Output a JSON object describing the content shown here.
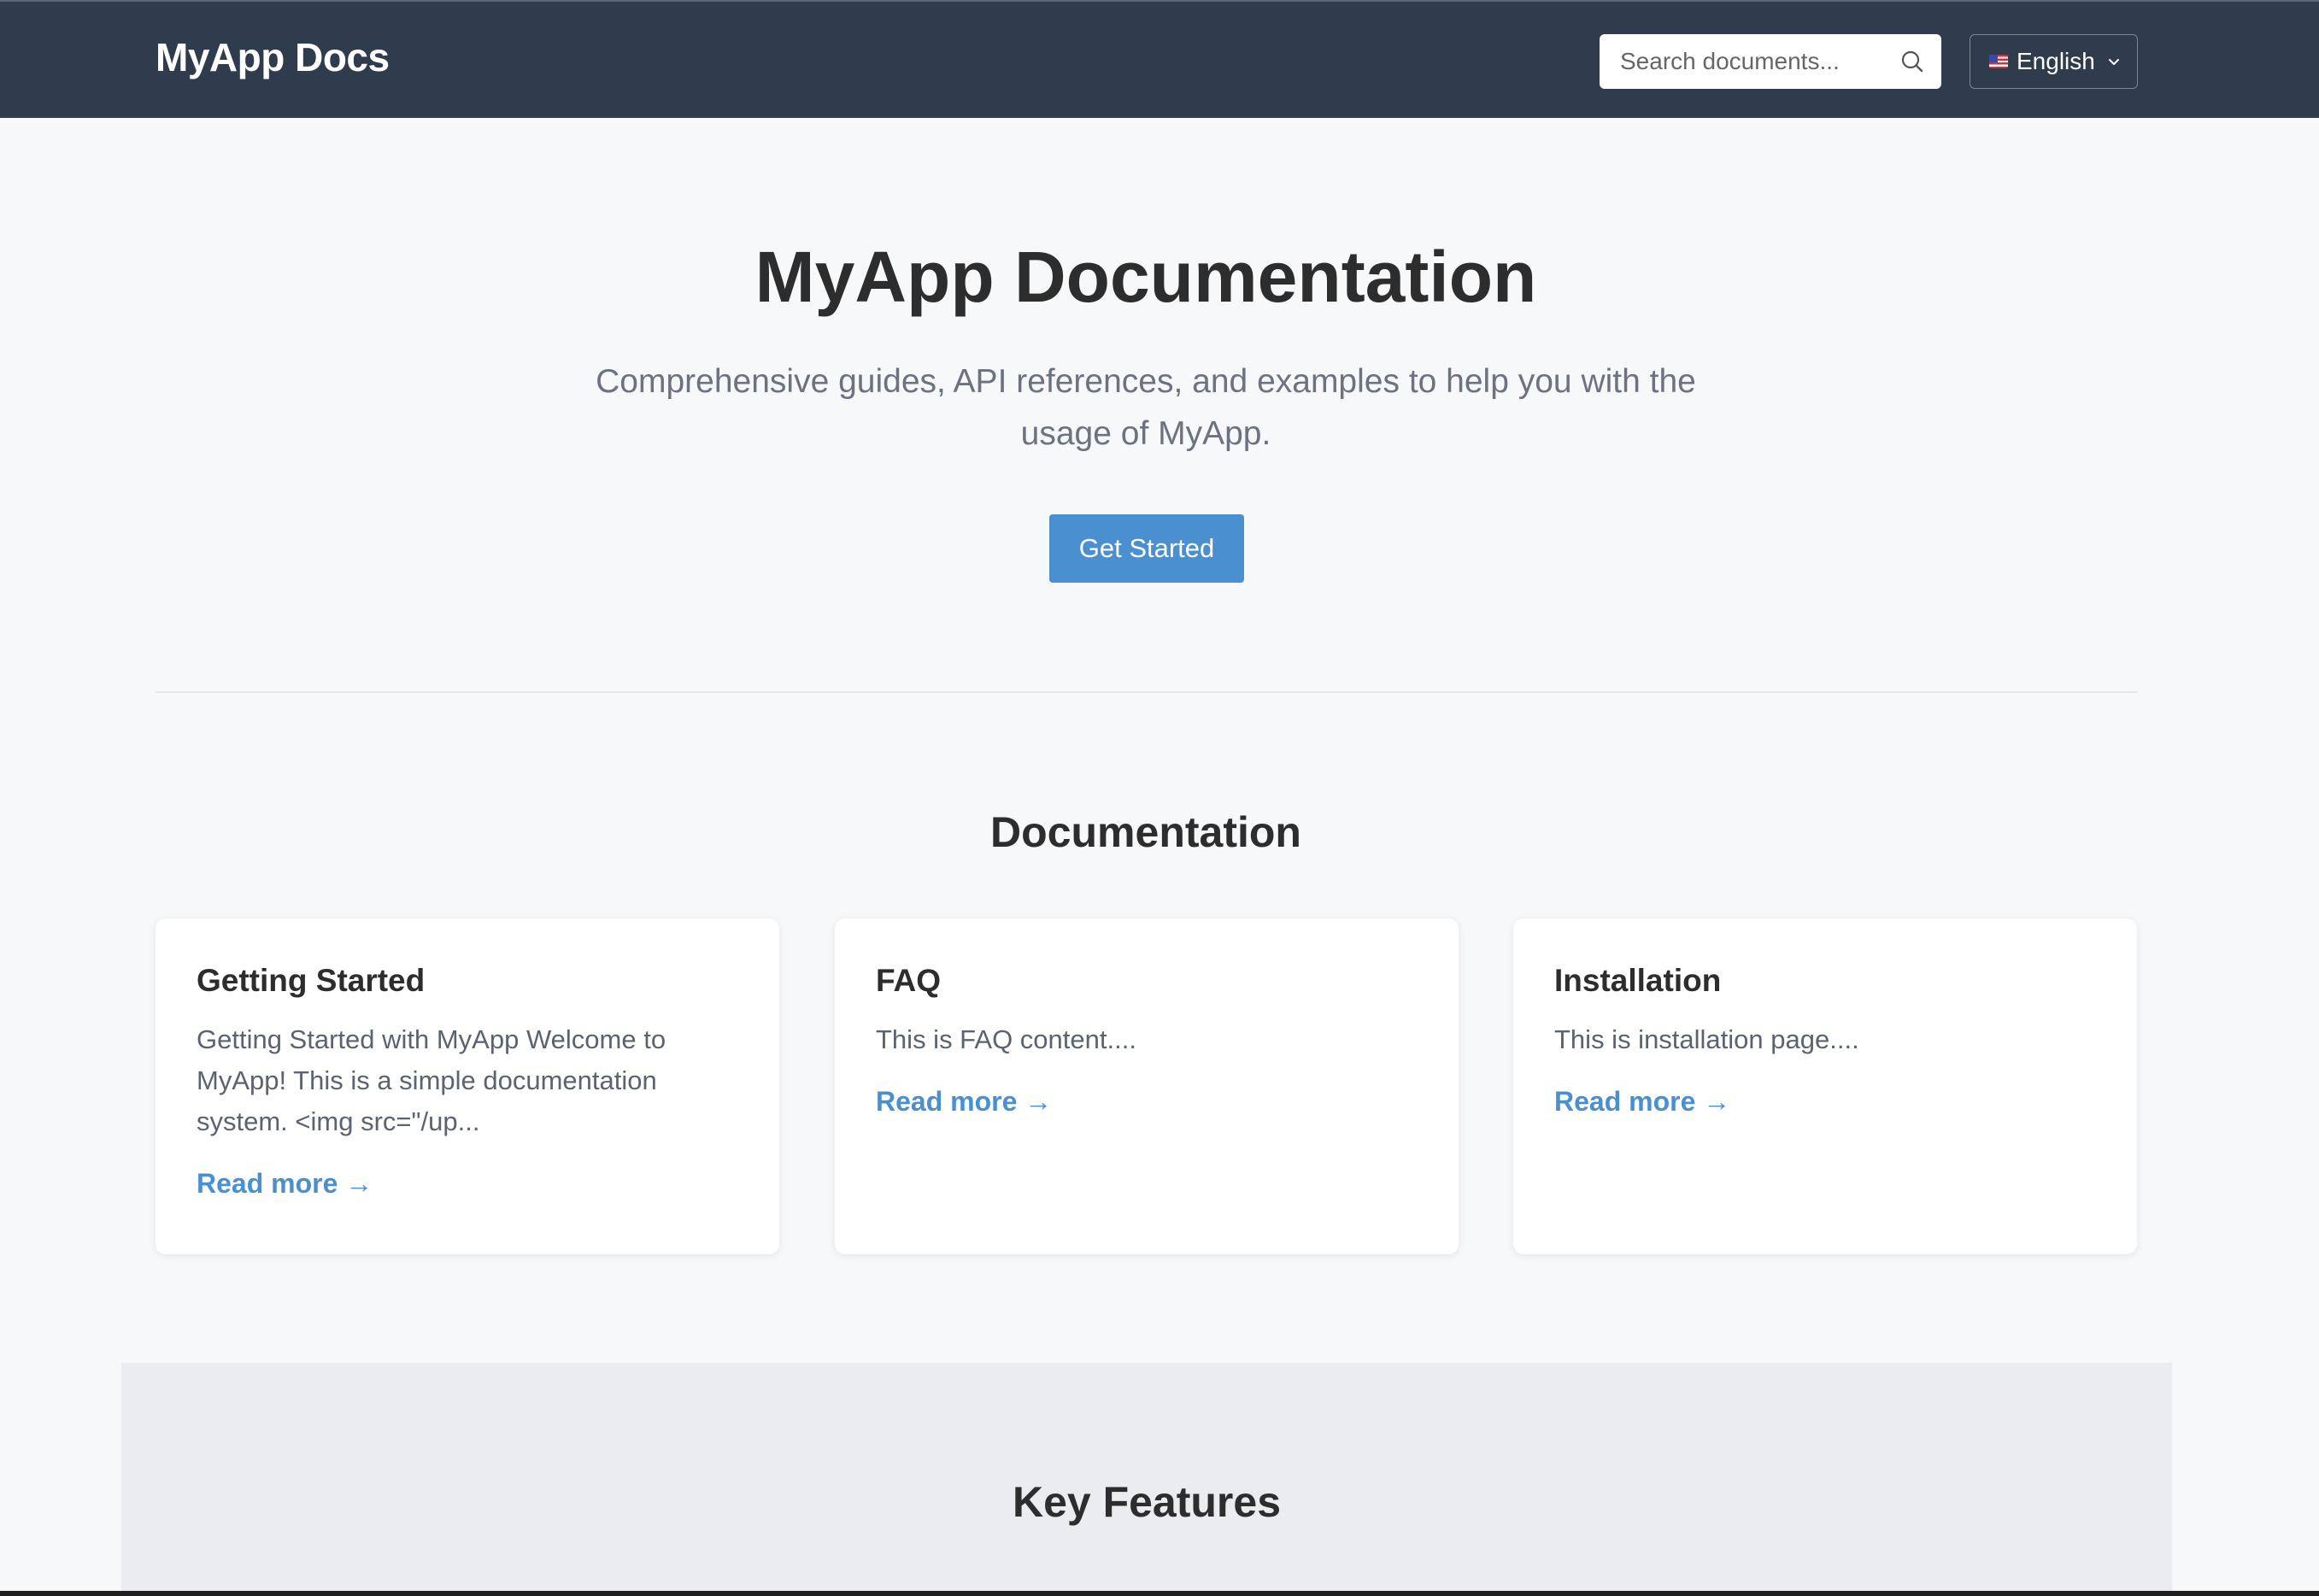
{
  "header": {
    "brand": "MyApp Docs",
    "search_placeholder": "Search documents...",
    "search_icon": "search-icon",
    "language": {
      "label": "English",
      "flag_icon": "us-flag-icon",
      "chevron_icon": "chevron-down-icon"
    }
  },
  "hero": {
    "title": "MyApp Documentation",
    "subtitle": "Comprehensive guides, API references, and examples to help you with the usage of MyApp.",
    "cta_label": "Get Started"
  },
  "documentation": {
    "title": "Documentation",
    "cards": [
      {
        "title": "Getting Started",
        "excerpt": "Getting Started with MyApp Welcome to MyApp! This is a simple documentation system. <img src=\"/up...",
        "link_label": "Read more →"
      },
      {
        "title": "FAQ",
        "excerpt": "This is FAQ content....",
        "link_label": "Read more →"
      },
      {
        "title": "Installation",
        "excerpt": "This is installation page....",
        "link_label": "Read more →"
      }
    ]
  },
  "features": {
    "title": "Key Features"
  },
  "colors": {
    "header_bg": "#2f3c4d",
    "accent": "#4a90d0",
    "page_bg": "#f7f8fa",
    "features_bg": "#ebecef"
  }
}
